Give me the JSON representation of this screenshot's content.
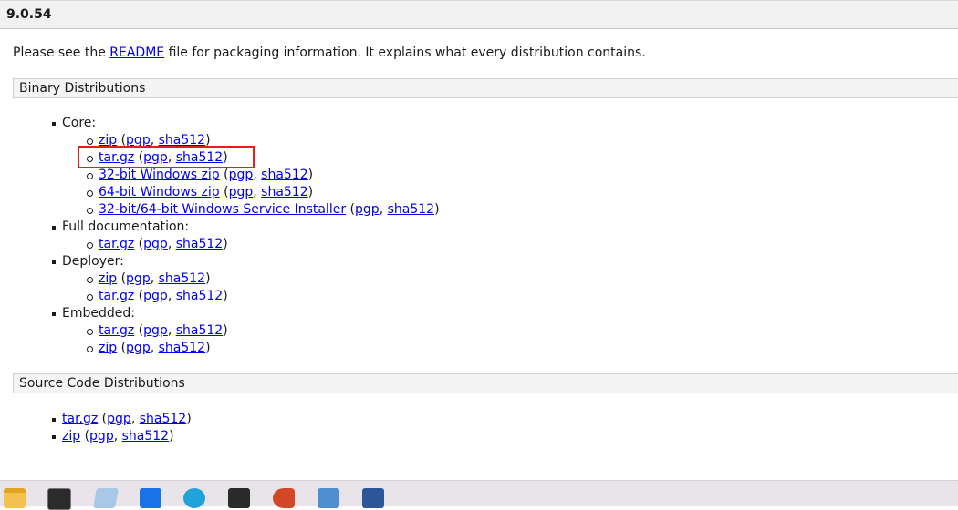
{
  "version": "9.0.54",
  "intro": {
    "before": "Please see the ",
    "link": "README",
    "after": " file for packaging information. It explains what every distribution contains."
  },
  "binary": {
    "heading": "Binary Distributions",
    "core_label": "Core:",
    "core": [
      {
        "main": "zip",
        "pgp": "pgp",
        "sha": "sha512"
      },
      {
        "main": "tar.gz",
        "pgp": "pgp",
        "sha": "sha512"
      },
      {
        "main": "32-bit Windows zip",
        "pgp": "pgp",
        "sha": "sha512"
      },
      {
        "main": "64-bit Windows zip",
        "pgp": "pgp",
        "sha": "sha512"
      },
      {
        "main": "32-bit/64-bit Windows Service Installer",
        "pgp": "pgp",
        "sha": "sha512"
      }
    ],
    "fulldoc_label": "Full documentation:",
    "fulldoc": [
      {
        "main": "tar.gz",
        "pgp": "pgp",
        "sha": "sha512"
      }
    ],
    "deployer_label": "Deployer:",
    "deployer": [
      {
        "main": "zip",
        "pgp": "pgp",
        "sha": "sha512"
      },
      {
        "main": "tar.gz",
        "pgp": "pgp",
        "sha": "sha512"
      }
    ],
    "embedded_label": "Embedded:",
    "embedded": [
      {
        "main": "tar.gz",
        "pgp": "pgp",
        "sha": "sha512"
      },
      {
        "main": "zip",
        "pgp": "pgp",
        "sha": "sha512"
      }
    ]
  },
  "source": {
    "heading": "Source Code Distributions",
    "items": [
      {
        "main": "tar.gz",
        "pgp": "pgp",
        "sha": "sha512"
      },
      {
        "main": "zip",
        "pgp": "pgp",
        "sha": "sha512"
      }
    ]
  },
  "taskbar": {
    "icons": [
      "file-explorer-icon",
      "terminal-icon",
      "notepad-icon",
      "app-icon",
      "edge-icon",
      "ide-icon",
      "powerpoint-icon",
      "archive-icon",
      "word-icon"
    ]
  }
}
